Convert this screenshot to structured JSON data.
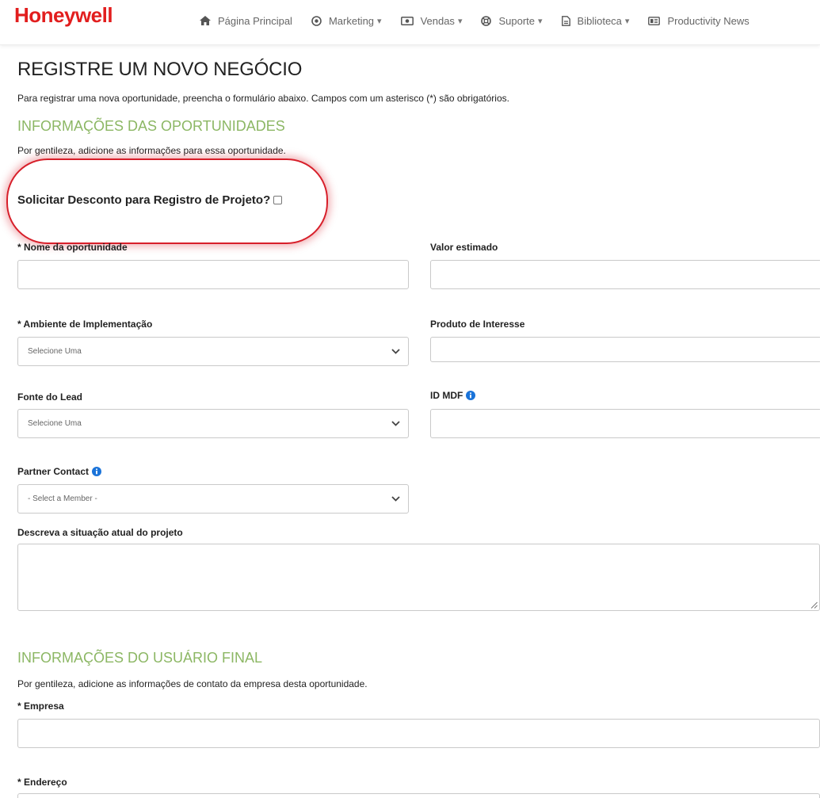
{
  "brand": {
    "name": "Honeywell",
    "color": "#e21e1e"
  },
  "nav": {
    "items": [
      {
        "label": "Página Principal",
        "icon": "home-icon",
        "has_dropdown": false
      },
      {
        "label": "Marketing",
        "icon": "target-icon",
        "has_dropdown": true
      },
      {
        "label": "Vendas",
        "icon": "cash-icon",
        "has_dropdown": true
      },
      {
        "label": "Suporte",
        "icon": "lifebuoy-icon",
        "has_dropdown": true
      },
      {
        "label": "Biblioteca",
        "icon": "document-icon",
        "has_dropdown": true
      },
      {
        "label": "Productivity News",
        "icon": "newspaper-icon",
        "has_dropdown": false
      }
    ],
    "caret": "▾"
  },
  "page": {
    "title": "REGISTRE UM NOVO NEGÓCIO",
    "intro": "Para registrar uma nova oportunidade, preencha o formulário abaixo. Campos com um asterisco (*) são obrigatórios."
  },
  "opportunity": {
    "heading": "INFORMAÇÕES DAS OPORTUNIDADES",
    "subtext": "Por gentileza, adicione as informações para essa oportunidade.",
    "discount_label": "Solicitar Desconto para Registro de Projeto?",
    "discount_checked": false,
    "fields": {
      "name": {
        "label": "* Nome da oportunidade",
        "value": ""
      },
      "value": {
        "label": "Valor estimado",
        "value": ""
      },
      "environment": {
        "label": "* Ambiente de Implementação",
        "selected": "Selecione Uma"
      },
      "product": {
        "label": "Produto de Interesse",
        "value": ""
      },
      "lead_source": {
        "label": "Fonte do Lead",
        "selected": "Selecione Uma"
      },
      "mdf": {
        "label": "ID MDF",
        "value": ""
      },
      "partner": {
        "label": "Partner Contact",
        "selected": "- Select a Member -"
      },
      "situation": {
        "label": "Descreva a situação atual do projeto",
        "value": ""
      }
    }
  },
  "end_user": {
    "heading": "INFORMAÇÕES DO USUÁRIO FINAL",
    "subtext": "Por gentileza, adicione as informações de contato da empresa desta oportunidade.",
    "fields": {
      "company": {
        "label": "* Empresa",
        "value": ""
      },
      "address": {
        "label": "* Endereço",
        "value": ""
      }
    }
  },
  "colors": {
    "section_heading": "#8cb764",
    "highlight_ring": "#d71f2a",
    "info_icon": "#1a73d9"
  }
}
